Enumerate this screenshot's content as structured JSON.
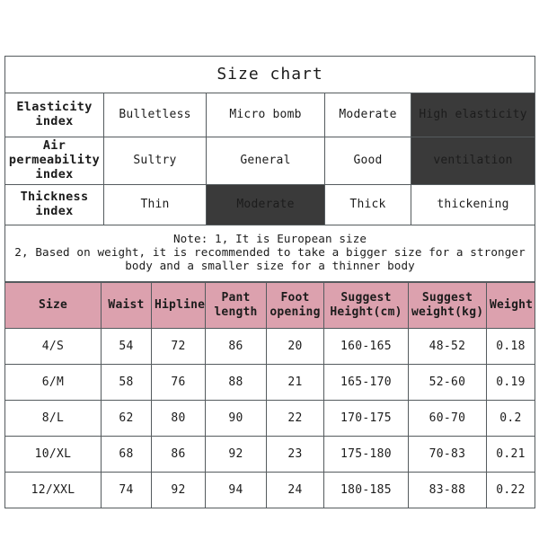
{
  "chart": {
    "title": "Size chart",
    "index_rows": [
      {
        "label": "Elasticity\nindex",
        "label_line1": "Elasticity",
        "label_line2": "index",
        "cells": [
          "Bulletless",
          "Micro bomb",
          "Moderate",
          "High elasticity"
        ],
        "highlight_index": 3
      },
      {
        "label_line1": "Air",
        "label_line2": "permeability",
        "label_line3": "index",
        "cells": [
          "Sultry",
          "General",
          "Good",
          "ventilation"
        ],
        "highlight_index": 3
      },
      {
        "label_line1": "Thickness",
        "label_line2": "index",
        "cells": [
          "Thin",
          "Moderate",
          "Thick",
          "thickening"
        ],
        "highlight_index": 1
      }
    ],
    "note": {
      "line1": "Note: 1, It is European size",
      "line2": "2, Based on weight, it is recommended to take a bigger size for a stronger body and a smaller size for a thinner body"
    },
    "size_table": {
      "headers": [
        {
          "line1": "Size",
          "line2": ""
        },
        {
          "line1": "Waist",
          "line2": ""
        },
        {
          "line1": "Hipline",
          "line2": ""
        },
        {
          "line1": "Pant",
          "line2": "length"
        },
        {
          "line1": "Foot",
          "line2": "opening"
        },
        {
          "line1": "Suggest",
          "line2": "Height(cm)"
        },
        {
          "line1": "Suggest",
          "line2": "weight(kg)"
        },
        {
          "line1": "Weight",
          "line2": ""
        }
      ],
      "rows": [
        [
          "4/S",
          "54",
          "72",
          "86",
          "20",
          "160-165",
          "48-52",
          "0.18"
        ],
        [
          "6/M",
          "58",
          "76",
          "88",
          "21",
          "165-170",
          "52-60",
          "0.19"
        ],
        [
          "8/L",
          "62",
          "80",
          "90",
          "22",
          "170-175",
          "60-70",
          "0.2"
        ],
        [
          "10/XL",
          "68",
          "86",
          "92",
          "23",
          "175-180",
          "70-83",
          "0.21"
        ],
        [
          "12/XXL",
          "74",
          "92",
          "94",
          "24",
          "180-185",
          "83-88",
          "0.22"
        ]
      ]
    },
    "colors": {
      "highlight_dark": "#3a3a3a",
      "header_pink": "#dca1ae",
      "border": "#555b5e",
      "background": "#ffffff",
      "text": "#1c1c1c"
    }
  }
}
